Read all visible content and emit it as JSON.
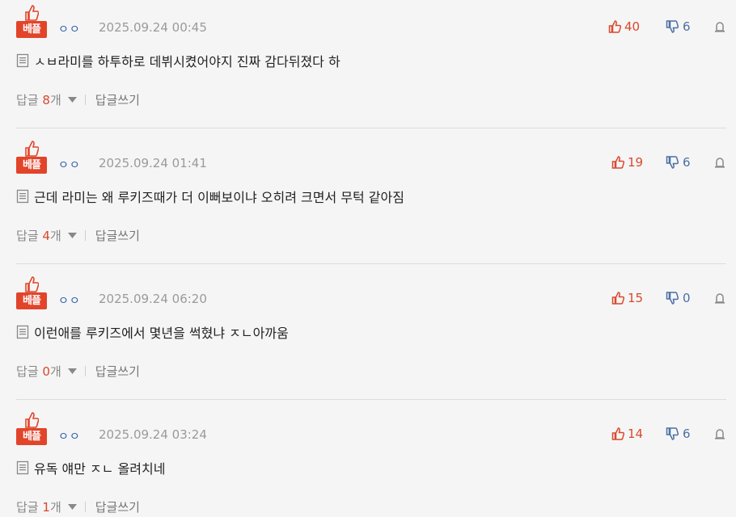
{
  "comments": [
    {
      "badge": "베플",
      "nick": "ㅇㅇ",
      "date": "2025.09.24 00:45",
      "upvotes": "40",
      "downvotes": "6",
      "text": "ㅅㅂ라미를 하투하로 데뷔시켰어야지 진짜 감다뒤졌다 하",
      "reply_label": "답글",
      "reply_count": "8",
      "reply_unit": "개",
      "write_reply": "답글쓰기"
    },
    {
      "badge": "베플",
      "nick": "ㅇㅇ",
      "date": "2025.09.24 01:41",
      "upvotes": "19",
      "downvotes": "6",
      "text": "근데 라미는 왜 루키즈때가 더 이뻐보이냐 오히려 크면서 무턱 같아짐",
      "reply_label": "답글",
      "reply_count": "4",
      "reply_unit": "개",
      "write_reply": "답글쓰기"
    },
    {
      "badge": "베플",
      "nick": "ㅇㅇ",
      "date": "2025.09.24 06:20",
      "upvotes": "15",
      "downvotes": "0",
      "text": "이런애를 루키즈에서 몇년을 썩혔냐 ㅈㄴ아까움",
      "reply_label": "답글",
      "reply_count": "0",
      "reply_unit": "개",
      "write_reply": "답글쓰기"
    },
    {
      "badge": "베플",
      "nick": "ㅇㅇ",
      "date": "2025.09.24 03:24",
      "upvotes": "14",
      "downvotes": "6",
      "text": "유독 얘만 ㅈㄴ 올려치네",
      "reply_label": "답글",
      "reply_count": "1",
      "reply_unit": "개",
      "write_reply": "답글쓰기"
    }
  ],
  "colors": {
    "badge_red": "#e2442a",
    "upvote_red": "#d9482c",
    "downvote_blue": "#4a6fa5",
    "nick_blue": "#2f5fa8"
  },
  "icons": {
    "badge": "thumbs-up-icon",
    "upvote": "thumbs-up-icon",
    "downvote": "thumbs-down-icon",
    "report": "report-icon",
    "comment_prefix": "document-icon",
    "reply_toggle": "caret-down-icon"
  }
}
